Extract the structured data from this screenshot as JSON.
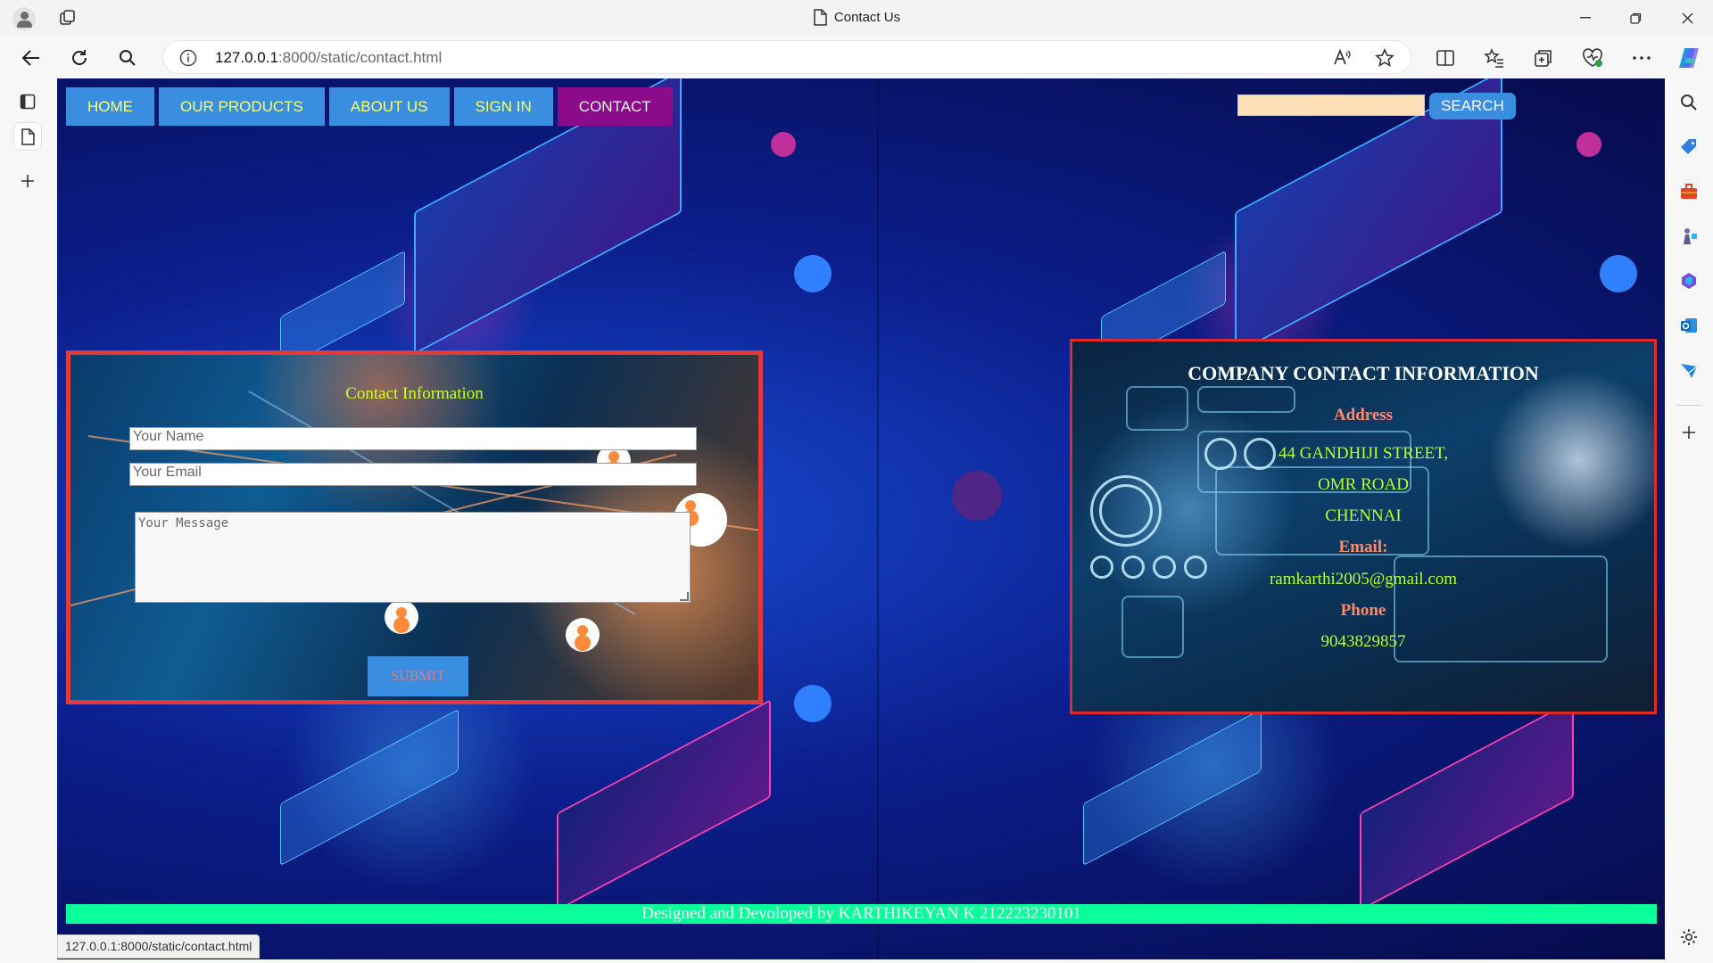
{
  "browser": {
    "tab_title": "Contact Us",
    "url_host": "127.0.0.1",
    "url_rest": ":8000/static/contact.html",
    "status_url": "127.0.0.1:8000/static/contact.html"
  },
  "nav": {
    "items": [
      {
        "label": "HOME"
      },
      {
        "label": "OUR PRODUCTS"
      },
      {
        "label": "ABOUT US"
      },
      {
        "label": "SIGN IN"
      },
      {
        "label": "CONTACT",
        "active": true
      }
    ],
    "search_value": "",
    "search_button": "SEARCH"
  },
  "form": {
    "title": "Contact Information",
    "name_placeholder": "Your Name",
    "email_placeholder": "Your Email",
    "message_placeholder": "Your Message",
    "submit_label": "SUBMIT"
  },
  "company": {
    "title": "COMPANY CONTACT INFORMATION",
    "address_label": "Address",
    "address_line1": "44 GANDHIJI STREET,",
    "address_line2": "OMR ROAD",
    "address_line3": "CHENNAI",
    "email_label": "Email:",
    "email_value": "ramkarthi2005@gmail.com",
    "phone_label": "Phone",
    "phone_value": "9043829857"
  },
  "footer": {
    "text": "Designed and Devoloped by KARTHIKEYAN K 212223230101"
  },
  "colors": {
    "nav_bg": "#3a8ee0",
    "nav_text": "#ffff66",
    "nav_active_bg": "#8a0c8a",
    "panel_border": "#e03a3a",
    "footer_bg": "#0aff9a",
    "form_title": "#c8ff2a",
    "info_label": "#ff8a6a",
    "info_value": "#b8ff2a"
  },
  "icons": {
    "titlebar": [
      "profile-icon",
      "workspaces-icon",
      "document-icon",
      "minimize-icon",
      "restore-icon",
      "close-icon"
    ],
    "toolbar": [
      "back-icon",
      "refresh-icon",
      "search-icon",
      "info-icon",
      "read-aloud-icon",
      "favorite-star-icon",
      "split-screen-icon",
      "favorites-icon",
      "collections-icon",
      "browser-essentials-icon",
      "more-icon",
      "copilot-icon"
    ],
    "tabstrip": [
      "tab-actions-icon",
      "page-tab-icon",
      "new-tab-icon"
    ],
    "sidebar": [
      "sidebar-search-icon",
      "shopping-icon",
      "tools-icon",
      "games-icon",
      "microsoft-365-icon",
      "outlook-icon",
      "drop-icon",
      "add-icon",
      "settings-icon"
    ]
  }
}
